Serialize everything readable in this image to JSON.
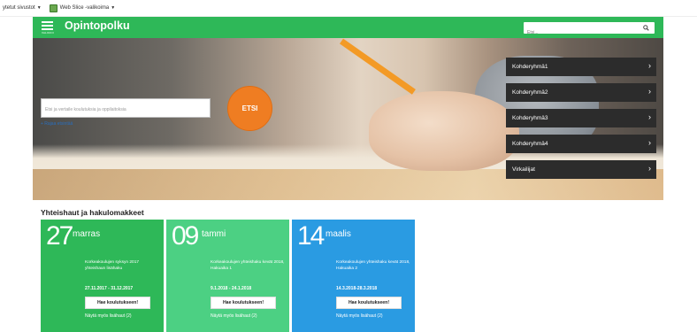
{
  "favorites": {
    "suggested_sites": "ytetut sivustot",
    "webslice": "Web Slice -valikoima"
  },
  "header": {
    "menu_label": "VALIKKO",
    "logo": "Opintopolku",
    "search_placeholder": "Etsi..."
  },
  "hero": {
    "search_placeholder": "Etsi ja vertaile koulutuksia ja oppilaitoksia",
    "refine_link": "+ Rajaa etsintää",
    "search_button": "ETSI",
    "targets": [
      "Kohderyhmä1",
      "Kohderyhmä2",
      "Kohderyhmä3",
      "Kohderyhmä4",
      "Virkailijat"
    ]
  },
  "section": {
    "title": "Yhteishaut ja hakulomakkeet"
  },
  "cards": [
    {
      "day": "27",
      "month": "marras",
      "description": "Korkeakoulujen syksyn 2017 yhteishaun lisähaku",
      "dates": "27.11.2017 - 31.12.2017",
      "button": "Hae koulutukseen!",
      "more": "Näytä myös lisähaut (2)",
      "color": "#2eb858"
    },
    {
      "day": "09",
      "month": "tammi",
      "description": "Korkeakoulujen yhteishaku kevät 2018, Hakuaika 1",
      "dates": "9.1.2018 - 24.1.2018",
      "button": "Hae koulutukseen!",
      "more": "Näytä myös lisähaut (2)",
      "color": "#4cd083"
    },
    {
      "day": "14",
      "month": "maalis",
      "description": "Korkeakoulujen yhteishaku kevät 2018, Hakuaika 2",
      "dates": "14.3.2018-28.3.2018",
      "button": "Hae koulutukseen!",
      "more": "Näytä myös lisähaut (2)",
      "color": "#2a9be2"
    }
  ]
}
